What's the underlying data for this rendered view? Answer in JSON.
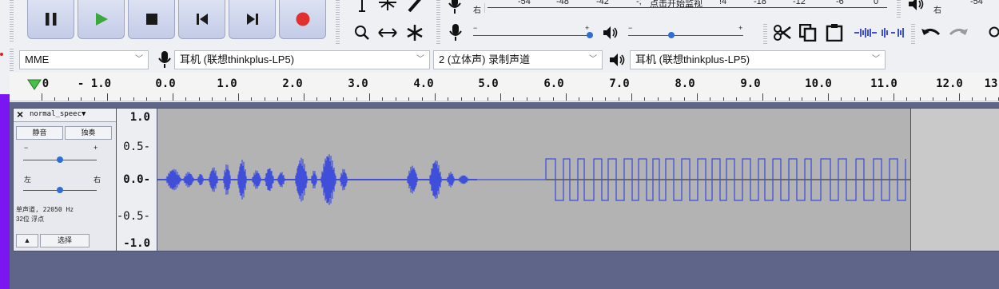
{
  "transport": {
    "pause": "pause-icon",
    "play": "play-icon",
    "stop": "stop-icon",
    "skip_start": "skip-to-start-icon",
    "skip_end": "skip-to-end-icon",
    "record": "record-icon",
    "colors": {
      "play": "#3aa83a",
      "record": "#e03030",
      "icon": "#1a1a1a"
    }
  },
  "meters": {
    "record_side_label": "右",
    "record_scale": [
      "-54",
      "-48",
      "-42",
      "-;",
      "点击开始监视",
      "!4",
      "-18",
      "-12",
      "-6",
      "0"
    ],
    "playback_side_label": "右",
    "playback_scale_first": "-54"
  },
  "device_bar": {
    "host": "MME",
    "recording_device": "耳机 (联想thinkplus-LP5)",
    "channels": "2 (立体声) 录制声道",
    "playback_device": "耳机 (联想thinkplus-LP5)"
  },
  "ruler": {
    "labels": [
      "0",
      "- 1.0",
      "0.0",
      "1.0",
      "2.0",
      "3.0",
      "4.0",
      "5.0",
      "6.0",
      "7.0",
      "8.0",
      "9.0",
      "10.0",
      "11.0",
      "12.0",
      "13"
    ]
  },
  "track": {
    "close": "×",
    "name": "normal_speec▼",
    "mute": "静音",
    "solo": "独奏",
    "gain_minus": "−",
    "gain_plus": "+",
    "pan_left": "左",
    "pan_right": "右",
    "info_line1": "单声道, 22050 Hz",
    "info_line2": "32位 浮点",
    "collapse": "▲",
    "select": "选择",
    "scale": [
      "1.0",
      "0.5-",
      "0.0-",
      "-0.5-",
      "-1.0"
    ],
    "waveform_color": "#3f4fd9"
  }
}
